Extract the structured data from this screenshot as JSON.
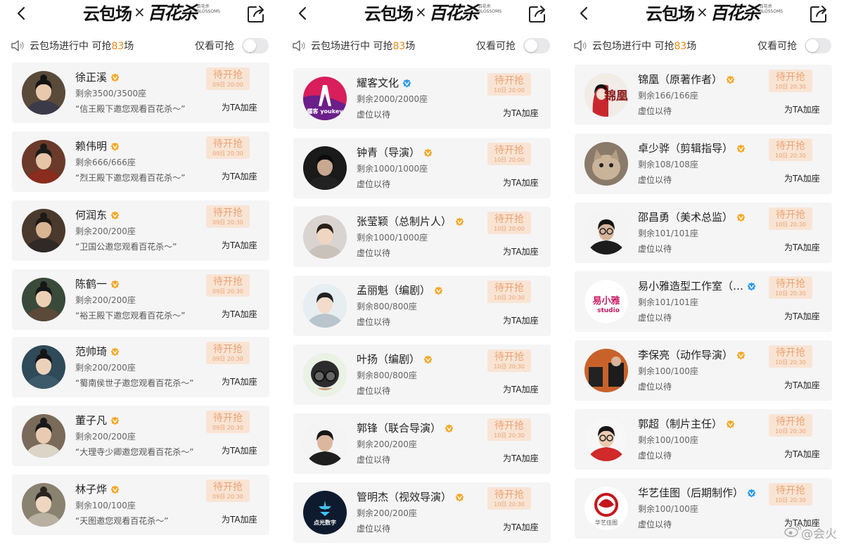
{
  "colors": {
    "accent": "#f08a19",
    "pending_bg": "#f9e4d4",
    "pending_text": "#e8a374",
    "card_bg": "#f5f5f6",
    "badge": "#f5a623"
  },
  "icons": {
    "back": "chevron-left",
    "share": "share-out",
    "speaker": "speaker",
    "verified": "v-badge"
  },
  "logo": {
    "brand": "云包场",
    "x": "×",
    "drama": "百花杀",
    "sub": "百花杀 BLOSSOMS"
  },
  "filter_label": "仅看可抢",
  "toggle_on": false,
  "panels": [
    {
      "status_prefix": "云包场进行中 可抢",
      "status_count": "83",
      "status_suffix": "场",
      "cards": [
        {
          "name": "徐正溪",
          "badge": "orange",
          "seats": "剩余3500/3500座",
          "line3": "“信王殿下邀您观看百花杀～”",
          "pending": "待开抢",
          "time": "09日 20:00",
          "button": "为TA加座"
        },
        {
          "name": "赖伟明",
          "badge": "orange",
          "seats": "剩余666/666座",
          "line3": "“烈王殿下邀您观看百花杀～”",
          "pending": "待开抢",
          "time": "09日 20:30",
          "button": "为TA加座"
        },
        {
          "name": "何润东",
          "badge": "orange",
          "seats": "剩余200/200座",
          "line3": "“卫国公邀您观看百花杀～”",
          "pending": "待开抢",
          "time": "09日 20:30",
          "button": "为TA加座"
        },
        {
          "name": "陈鹤一",
          "badge": "orange",
          "seats": "剩余200/200座",
          "line3": "“裕王殿下邀您观看百花杀～”",
          "pending": "待开抢",
          "time": "09日 20:30",
          "button": "为TA加座"
        },
        {
          "name": "范帅琦",
          "badge": "orange",
          "seats": "剩余200/200座",
          "line3": "“蜀南侯世子邀您观看百花杀～”",
          "pending": "待开抢",
          "time": "09日 20:30",
          "button": "为TA加座"
        },
        {
          "name": "董子凡",
          "badge": "orange",
          "seats": "剩余200/200座",
          "line3": "“大理寺少卿邀您观看百花杀～”",
          "pending": "待开抢",
          "time": "09日 20:30",
          "button": "为TA加座"
        },
        {
          "name": "林子烨",
          "badge": "orange",
          "seats": "剩余100/100座",
          "line3": "“天图邀您观看百花杀～”",
          "pending": "待开抢",
          "time": "09日 20:30",
          "button": "为TA加座"
        }
      ]
    },
    {
      "status_prefix": "云包场进行中 可抢",
      "status_count": "83",
      "status_suffix": "场",
      "cards": [
        {
          "name": "耀客文化",
          "badge": "blue",
          "seats": "剩余2000/2000座",
          "line3": "虚位以待",
          "pending": "待开抢",
          "time": "10日 20:00",
          "button": "为TA加座"
        },
        {
          "name": "钟青（导演）",
          "badge": "orange",
          "seats": "剩余1000/1000座",
          "line3": "虚位以待",
          "pending": "待开抢",
          "time": "10日 20:00",
          "button": "为TA加座"
        },
        {
          "name": "张莹颖（总制片人）",
          "badge": "orange",
          "seats": "剩余1000/1000座",
          "line3": "虚位以待",
          "pending": "待开抢",
          "time": "10日 20:00",
          "button": "为TA加座"
        },
        {
          "name": "孟丽魁（编剧）",
          "badge": "orange",
          "seats": "剩余800/800座",
          "line3": "虚位以待",
          "pending": "待开抢",
          "time": "10日 20:30",
          "button": "为TA加座"
        },
        {
          "name": "叶扬（编剧）",
          "badge": "orange",
          "seats": "剩余800/800座",
          "line3": "虚位以待",
          "pending": "待开抢",
          "time": "10日 20:30",
          "button": "为TA加座"
        },
        {
          "name": "郭锋（联合导演）",
          "badge": "orange",
          "seats": "剩余200/200座",
          "line3": "虚位以待",
          "pending": "待开抢",
          "time": "10日 20:30",
          "button": "为TA加座"
        },
        {
          "name": "管明杰（视效导演）",
          "badge": "orange",
          "seats": "剩余200/200座",
          "line3": "虚位以待",
          "pending": "待开抢",
          "time": "10日 20:30",
          "button": "为TA加座"
        }
      ]
    },
    {
      "status_prefix": "云包场进行中 可抢",
      "status_count": "83",
      "status_suffix": "场",
      "cards": [
        {
          "name": "锦凰（原著作者）",
          "badge": "orange",
          "seats": "剩余166/166座",
          "line3": "虚位以待",
          "pending": "待开抢",
          "time": "10日 20:30",
          "button": "为TA加座"
        },
        {
          "name": "卓少骅（剪辑指导）",
          "badge": "orange",
          "seats": "剩余108/108座",
          "line3": "虚位以待",
          "pending": "待开抢",
          "time": "10日 20:30",
          "button": "为TA加座"
        },
        {
          "name": "邵昌勇（美术总监）",
          "badge": "orange",
          "seats": "剩余101/101座",
          "line3": "虚位以待",
          "pending": "待开抢",
          "time": "10日 20:30",
          "button": "为TA加座"
        },
        {
          "name": "易小雅造型工作室（…",
          "badge": "blue",
          "seats": "剩余101/101座",
          "line3": "虚位以待",
          "pending": "待开抢",
          "time": "10日 20:30",
          "button": "为TA加座"
        },
        {
          "name": "李保亮（动作导演）",
          "badge": "orange",
          "seats": "剩余100/100座",
          "line3": "虚位以待",
          "pending": "待开抢",
          "time": "10日 20:30",
          "button": "为TA加座"
        },
        {
          "name": "郭超（制片主任）",
          "badge": "orange",
          "seats": "剩余100/100座",
          "line3": "虚位以待",
          "pending": "待开抢",
          "time": "10日 20:30",
          "button": "为TA加座"
        },
        {
          "name": "华艺佳图（后期制作）",
          "badge": "blue",
          "seats": "剩余100/100座",
          "line3": "虚位以待",
          "pending": "待开抢",
          "time": "10日 20:30",
          "button": "为TA加座"
        }
      ]
    }
  ],
  "avatar_text": {
    "yaoke": "耀客 youkey",
    "jinhuang": "锦凰",
    "yixiaoya": "易小雅",
    "yixiaoya_sub": "studio",
    "guangming": "点光数字",
    "huayi": "华艺佳图"
  },
  "watermark": "@会火"
}
